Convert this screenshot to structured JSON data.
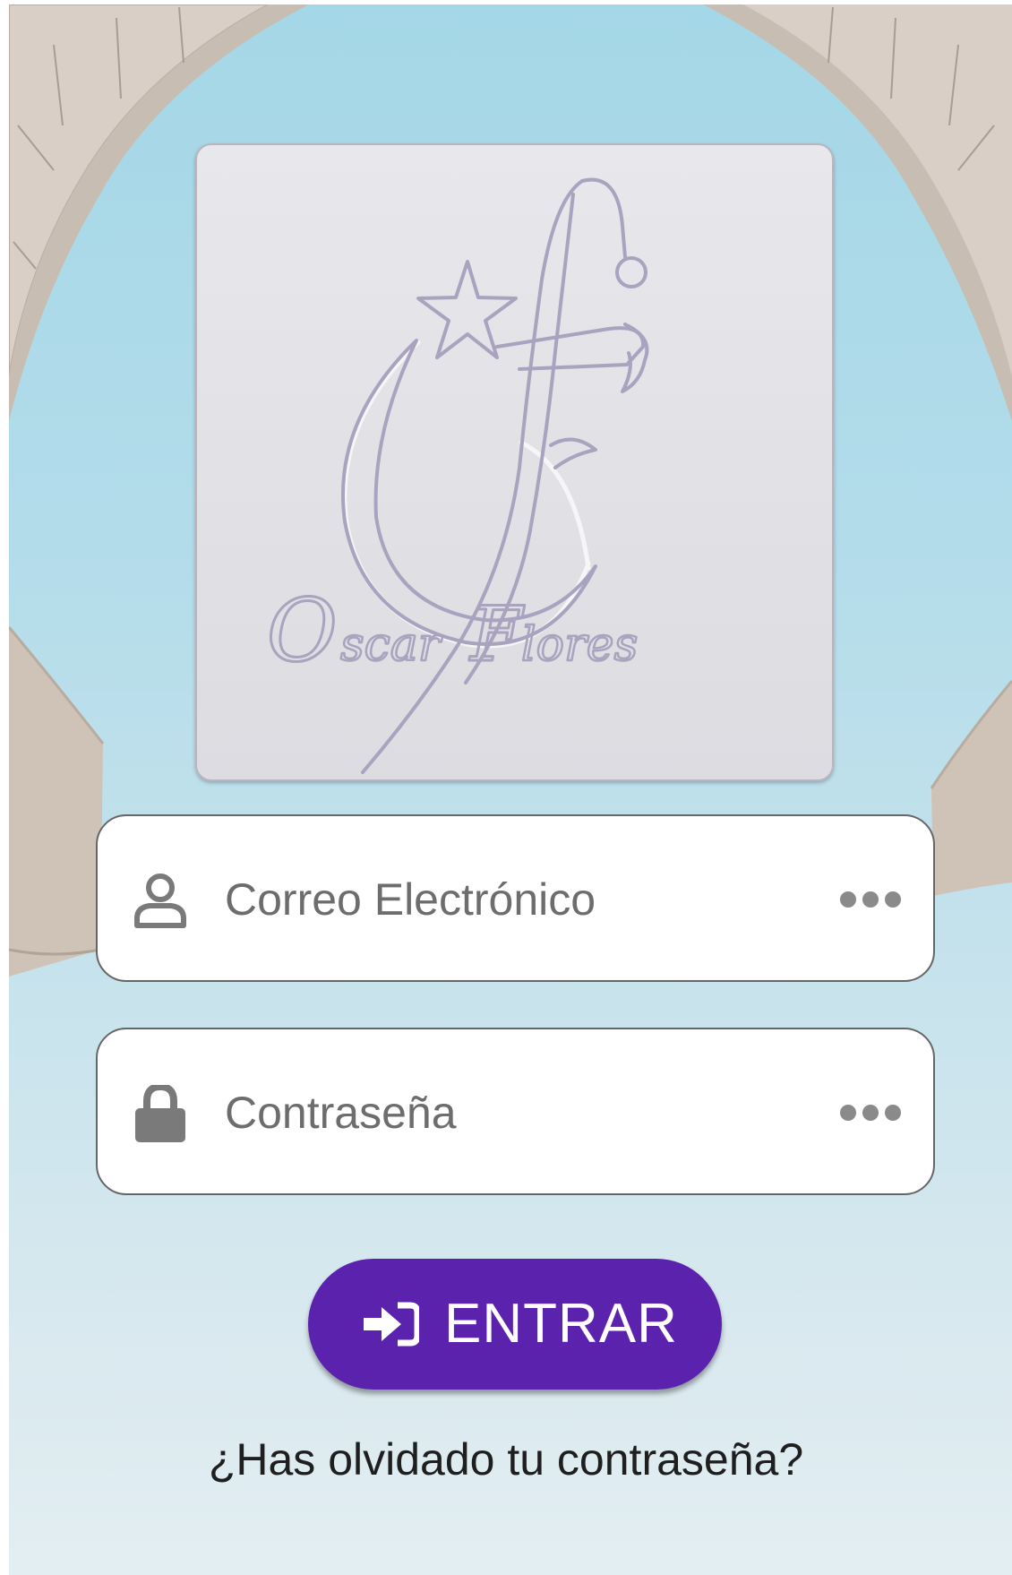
{
  "logo": {
    "brand_text": "Oscar Flores",
    "icons": [
      "star-icon",
      "crescent-icon",
      "sword-icon"
    ]
  },
  "form": {
    "email": {
      "placeholder": "Correo Electrónico",
      "value": "",
      "icon": "user-icon",
      "trailing_icon": "more-dots-icon"
    },
    "password": {
      "placeholder": "Contraseña",
      "value": "",
      "icon": "lock-icon",
      "trailing_icon": "more-dots-icon"
    }
  },
  "actions": {
    "enter_label": "ENTRAR",
    "enter_icon": "login-icon",
    "forgot_label": "¿Has olvidado tu contraseña?"
  },
  "colors": {
    "accent": "#5b22ad",
    "field_border": "#666666",
    "icon_gray": "#7a7a7a",
    "logo_stroke": "#a9a3bf",
    "sky": "#a4d7e7"
  }
}
